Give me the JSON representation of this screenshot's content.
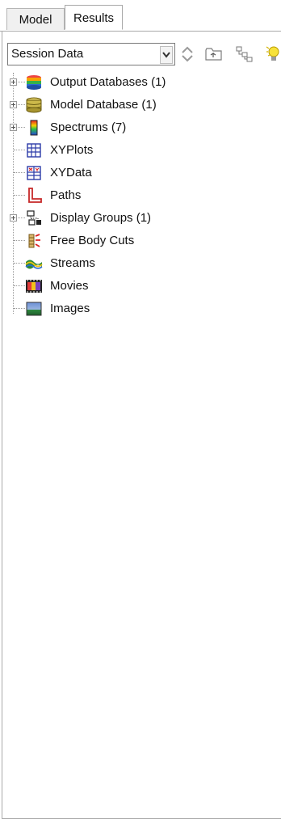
{
  "tabs": [
    {
      "label": "Model",
      "active": false
    },
    {
      "label": "Results",
      "active": true
    }
  ],
  "toolbar": {
    "combo_value": "Session Data",
    "icons": [
      "spinner-icon",
      "parent-folder-icon",
      "tree-filter-icon",
      "lightbulb-icon"
    ]
  },
  "tree": {
    "items": [
      {
        "label": "Output Databases (1)",
        "expandable": true,
        "icon": "output-databases-icon"
      },
      {
        "label": "Model Database (1)",
        "expandable": true,
        "icon": "model-database-icon"
      },
      {
        "label": "Spectrums (7)",
        "expandable": true,
        "icon": "spectrums-icon"
      },
      {
        "label": "XYPlots",
        "expandable": false,
        "icon": "xyplots-icon"
      },
      {
        "label": "XYData",
        "expandable": false,
        "icon": "xydata-icon"
      },
      {
        "label": "Paths",
        "expandable": false,
        "icon": "paths-icon"
      },
      {
        "label": "Display Groups (1)",
        "expandable": true,
        "icon": "display-groups-icon"
      },
      {
        "label": "Free Body Cuts",
        "expandable": false,
        "icon": "free-body-cuts-icon"
      },
      {
        "label": "Streams",
        "expandable": false,
        "icon": "streams-icon"
      },
      {
        "label": "Movies",
        "expandable": false,
        "icon": "movies-icon"
      },
      {
        "label": "Images",
        "expandable": false,
        "icon": "images-icon"
      }
    ]
  },
  "colors": {
    "border": "#a9a9a9",
    "inactive_tab": "#f0f0f0",
    "background": "#ffffff"
  }
}
